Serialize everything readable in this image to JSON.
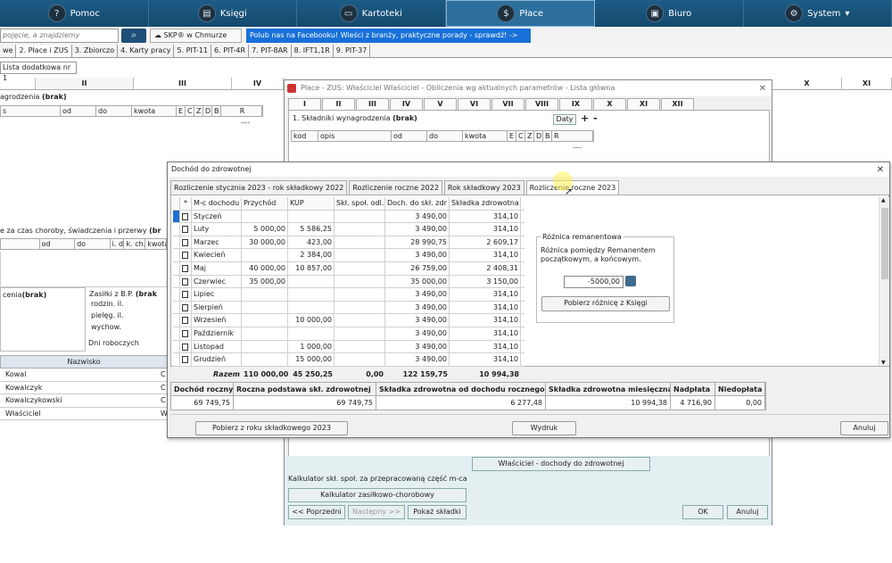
{
  "topnav": [
    {
      "label": "Pomoc",
      "icon": "help-icon"
    },
    {
      "label": "Księgi",
      "icon": "books-icon"
    },
    {
      "label": "Kartoteki",
      "icon": "folder-icon"
    },
    {
      "label": "Płace",
      "icon": "payroll-icon"
    },
    {
      "label": "Biuro",
      "icon": "office-icon"
    },
    {
      "label": "System",
      "icon": "system-icon"
    }
  ],
  "search": {
    "placeholder": "pojęcie, a znajdziemy odpowiedź",
    "skp": "SKP® w Chmurze",
    "banner": "Polub nas na Facebooku! Wieści z branży, praktyczne porady - sprawdź! ->"
  },
  "maintabs": [
    "we",
    "2. Płace i ZUS",
    "3. Zbiorczo",
    "4. Karty pracy",
    "5. PIT-11",
    "6. PIT-4R",
    "7. PIT-8AR",
    "8. IFT1,1R",
    "9. PIT-37"
  ],
  "sublist": "Lista dodatkowa nr 1",
  "bgroman": [
    "II",
    "III",
    "IV",
    "X",
    "XI"
  ],
  "bg": {
    "wynagrodzenia": "agrodzenia",
    "brak": "(brak)",
    "choroby": "e za czas choroby, świadczenia i przerwy",
    "chor_brak": "(br",
    "cenia": "cenia",
    "zasilki": "Zasiłki z B.P.",
    "zas_brak": "(brak",
    "rodzin": "rodzin. il.",
    "piel": "pielęg. il.",
    "wychow": "wychow.",
    "dni": "Dni roboczych",
    "dashes": "----",
    "hdr1": [
      "s",
      "od",
      "do",
      "kwota",
      "E",
      "C",
      "Z",
      "D",
      "B",
      "R"
    ],
    "hdr2": [
      "od",
      "do",
      "i. d",
      "k. ch.",
      "kwota"
    ],
    "nazwisko": "Nazwisko",
    "names": [
      "Kowal",
      "Kowalczyk",
      "Kowalczykowski",
      "Właściciel"
    ],
    "names_code": [
      "C",
      "C",
      "C",
      "W"
    ]
  },
  "place": {
    "title": "Płace - ZUS: Właściciel Właściciel - Obliczenia wg aktualnych parametrów - Lista główna",
    "roman": [
      "I",
      "II",
      "III",
      "IV",
      "V",
      "VI",
      "VII",
      "VIII",
      "IX",
      "X",
      "XI",
      "XII"
    ],
    "skladniki": "1. Składniki wynagrodzenia",
    "sk_brak": "(brak)",
    "daty": "Daty",
    "plus": "+",
    "minus": "-",
    "hdr": [
      "kod",
      "opis",
      "od",
      "do",
      "kwota",
      "E",
      "C",
      "Z",
      "D",
      "B",
      "R"
    ],
    "dashes": "----",
    "btn_wlasc": "Właściciel - dochody do zdrowotnej",
    "kalk1": "Kalkulator skł. społ. za przepracowaną część m-ca",
    "kalk2": "Kalkulator zasiłkowo-chorobowy",
    "poprzedni": "<< Poprzedni",
    "nastepny": "Następny >>",
    "pokaz": "Pokaż składki",
    "ok": "OK",
    "anuluj": "Anuluj"
  },
  "doch": {
    "title": "Dochód do zdrowotnej",
    "close": "✕",
    "tabs": [
      "Rozliczenie stycznia 2023 - rok składkowy 2022",
      "Rozliczenie roczne 2022",
      "Rok składkowy 2023",
      "Rozliczenie roczne 2023"
    ],
    "grid_hdr": [
      "*",
      "M-c dochodu",
      "Przychód",
      "KUP",
      "Skł. społ. odl.",
      "Doch. do skł. zdr",
      "Składka zdrowotna"
    ],
    "rows": [
      [
        "Styczeń",
        "",
        "",
        "",
        "3 490,00",
        "314,10"
      ],
      [
        "Luty",
        "5 000,00",
        "5 586,25",
        "",
        "3 490,00",
        "314,10"
      ],
      [
        "Marzec",
        "30 000,00",
        "423,00",
        "",
        "28 990,75",
        "2 609,17"
      ],
      [
        "Kwiecień",
        "",
        "2 384,00",
        "",
        "3 490,00",
        "314,10"
      ],
      [
        "Maj",
        "40 000,00",
        "10 857,00",
        "",
        "26 759,00",
        "2 408,31"
      ],
      [
        "Czerwiec",
        "35 000,00",
        "",
        "",
        "35 000,00",
        "3 150,00"
      ],
      [
        "Lipiec",
        "",
        "",
        "",
        "3 490,00",
        "314,10"
      ],
      [
        "Sierpień",
        "",
        "",
        "",
        "3 490,00",
        "314,10"
      ],
      [
        "Wrzesień",
        "",
        "10 000,00",
        "",
        "3 490,00",
        "314,10"
      ],
      [
        "Październik",
        "",
        "",
        "",
        "3 490,00",
        "314,10"
      ],
      [
        "Listopad",
        "",
        "1 000,00",
        "",
        "3 490,00",
        "314,10"
      ],
      [
        "Grudzień",
        "",
        "15 000,00",
        "",
        "3 490,00",
        "314,10"
      ]
    ],
    "total": [
      "Razem",
      "110 000,00",
      "45 250,25",
      "0,00",
      "122 159,75",
      "10 994,38"
    ],
    "rozn_title": "Różnica remanentowa",
    "rozn_desc": "Różnica pomiędzy Remanentem początkowym, a końcowym.",
    "rozn_value": "-5000,00",
    "rozn_btn": "Pobierz różnicę z Księgi",
    "sum_hdr": [
      "Dochód roczny",
      "Roczna podstawa skł. zdrowotnej",
      "Składka zdrowotna od dochodu rocznego",
      "Składka zdrowotna miesięczna",
      "Nadpłata",
      "Niedopłata"
    ],
    "sum_val": [
      "69 749,75",
      "69 749,75",
      "6 277,48",
      "10 994,38",
      "4 716,90",
      "0,00"
    ],
    "btn_pobierz": "Pobierz z roku składkowego 2023",
    "btn_wydruk": "Wydruk",
    "btn_anuluj": "Anuluj"
  }
}
